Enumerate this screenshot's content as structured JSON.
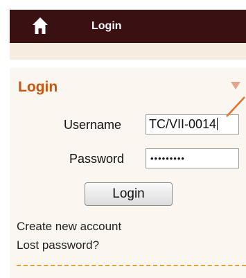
{
  "nav": {
    "home_icon": "home-icon",
    "tab_label": "Login"
  },
  "panel": {
    "title": "Login",
    "collapse_icon": "triangle-down-icon",
    "username_label": "Username",
    "username_value": "TC/VII-0014",
    "password_label": "Password",
    "password_value": "•••••••••",
    "login_button_label": "Login",
    "create_account_link": "Create new account",
    "lost_password_link": "Lost password?"
  },
  "colors": {
    "nav_background": "#3a1012",
    "panel_background": "#fbf6ef",
    "title_color": "#c8560e",
    "divider_color": "#e6a23c",
    "annotation_arrow": "#e8712a"
  }
}
